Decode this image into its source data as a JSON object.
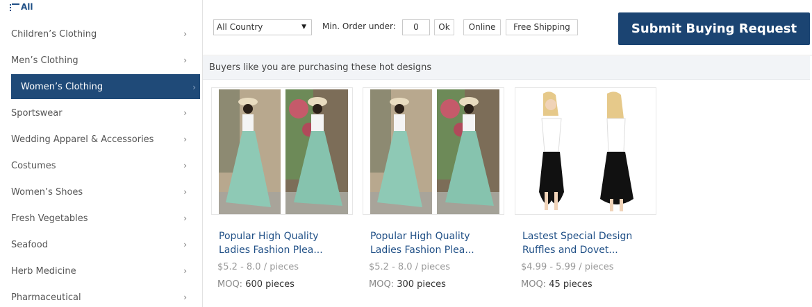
{
  "sidebar": {
    "all_label": "All",
    "items": [
      {
        "label": "Children’s Clothing"
      },
      {
        "label": "Men’s Clothing"
      },
      {
        "label": "Women’s Clothing",
        "active": true
      },
      {
        "label": "Sportswear"
      },
      {
        "label": "Wedding Apparel & Accessories"
      },
      {
        "label": "Costumes"
      },
      {
        "label": "Women’s Shoes"
      },
      {
        "label": "Fresh Vegetables"
      },
      {
        "label": "Seafood"
      },
      {
        "label": "Herb Medicine"
      },
      {
        "label": "Pharmaceutical"
      }
    ],
    "chevron": "›"
  },
  "filter": {
    "country_value": "All Country",
    "min_order_label": "Min. Order under:",
    "min_order_value": "0",
    "ok_label": "Ok",
    "online_label": "Online",
    "free_shipping_label": "Free Shipping",
    "submit_label": "Submit Buying Request"
  },
  "hot_bar": {
    "text": "Buyers like you are purchasing these hot designs"
  },
  "products": [
    {
      "title_line1": "Popular High Quality",
      "title_line2": "Ladies Fashion Plea...",
      "price": "$5.2 - 8.0 / pieces",
      "moq_label": "MOQ:",
      "moq_value": "600 pieces"
    },
    {
      "title_line1": "Popular High Quality",
      "title_line2": "Ladies Fashion Plea...",
      "price": "$5.2 - 8.0 / pieces",
      "moq_label": "MOQ:",
      "moq_value": "300 pieces"
    },
    {
      "title_line1": "Lastest Special Design",
      "title_line2": "Ruffles and Dovet...",
      "price": "$4.99 - 5.99 / pieces",
      "moq_label": "MOQ:",
      "moq_value": "45 pieces"
    }
  ],
  "colors": {
    "brand": "#1b4472",
    "link": "#1f4f86",
    "active_bg": "#1f4a78"
  }
}
